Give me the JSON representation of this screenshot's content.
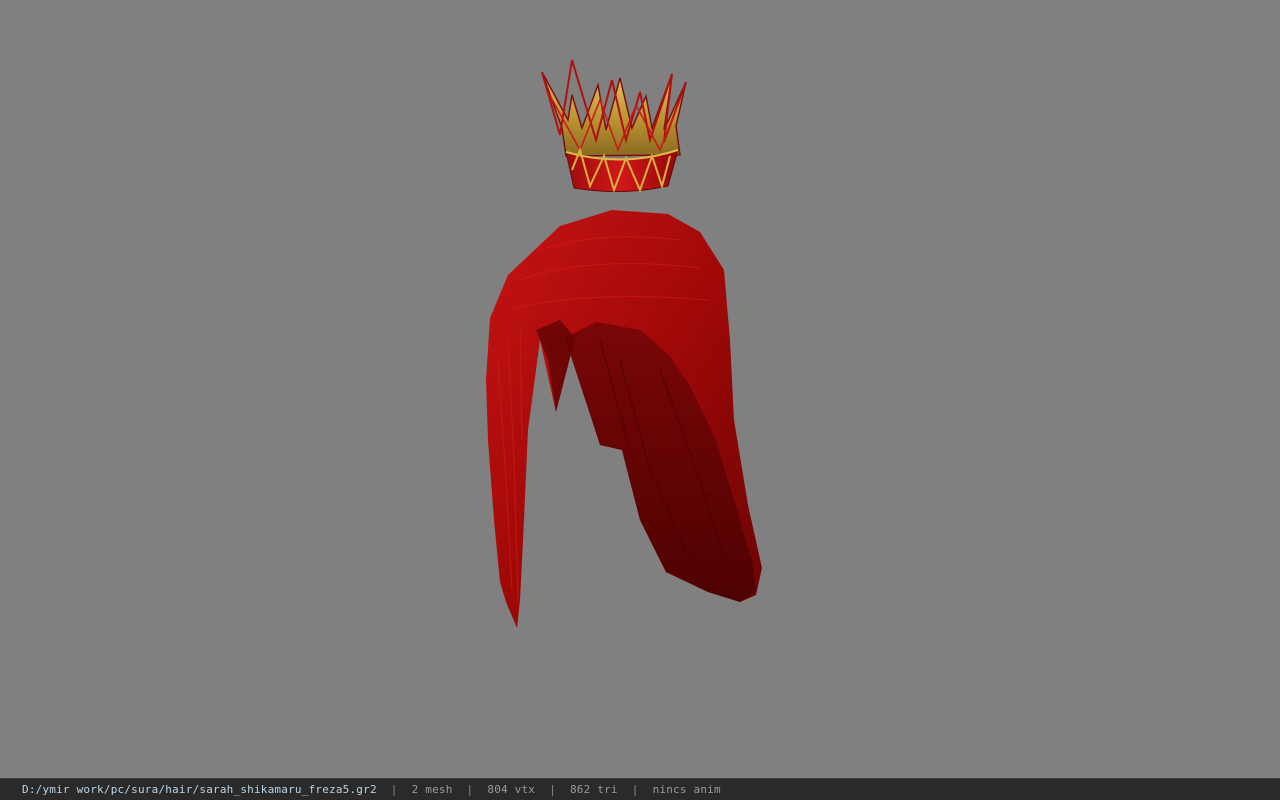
{
  "viewport": {
    "background_color": "#808080",
    "model": {
      "parts": [
        "crown",
        "hair"
      ],
      "hair_color": "#b00a0a",
      "crown_gold": "#c9a23a",
      "crown_red": "#b01010"
    }
  },
  "status_bar": {
    "file_path": "D:/ymir work/pc/sura/hair/sarah_shikamaru_freza5.gr2",
    "mesh_count": "2 mesh",
    "vertex_count": "804 vtx",
    "triangle_count": "862 tri",
    "anim_info": "nincs anim",
    "separator": "|"
  }
}
